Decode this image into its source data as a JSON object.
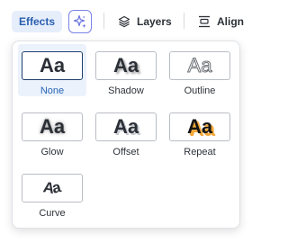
{
  "toolbar": {
    "effects_label": "Effects",
    "magic_icon": "sparkles-icon",
    "layers_label": "Layers",
    "align_label": "Align"
  },
  "effects": [
    {
      "name": "none",
      "label": "None",
      "sample": "Aa",
      "selected": true
    },
    {
      "name": "shadow",
      "label": "Shadow",
      "sample": "Aa",
      "selected": false
    },
    {
      "name": "outline",
      "label": "Outline",
      "sample": "Aa",
      "selected": false
    },
    {
      "name": "glow",
      "label": "Glow",
      "sample": "Aa",
      "selected": false
    },
    {
      "name": "offset",
      "label": "Offset",
      "sample": "Aa",
      "selected": false
    },
    {
      "name": "repeat",
      "label": "Repeat",
      "sample": "Aa",
      "selected": false
    },
    {
      "name": "curve",
      "label": "Curve",
      "sample": "Aa",
      "selected": false
    }
  ],
  "colors": {
    "accent": "#2a64b5",
    "selected_bg": "#ebf2fc",
    "repeat_shadow": "#f3a93a"
  }
}
